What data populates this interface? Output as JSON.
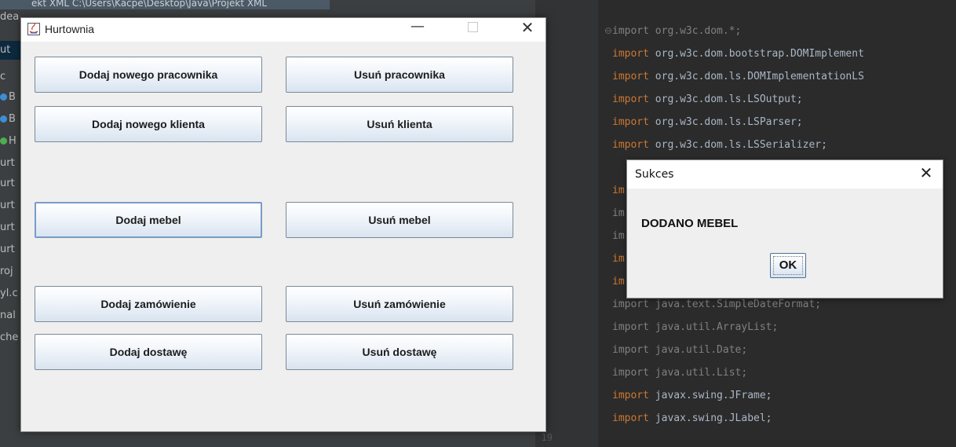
{
  "ide": {
    "project_path": "ekt XML  C:\\Users\\Kacpe\\Desktop\\Java\\Projekt XML",
    "side_fragments": [
      {
        "text": "dea",
        "dot": ""
      },
      {
        "text": "ut",
        "dot": ""
      },
      {
        "text": "c",
        "dot": ""
      },
      {
        "text": "B",
        "dot": "#3d8ed6"
      },
      {
        "text": "B",
        "dot": "#3d8ed6"
      },
      {
        "text": "H",
        "dot": "#4caf50"
      },
      {
        "text": "urt",
        "dot": ""
      },
      {
        "text": "urt",
        "dot": ""
      },
      {
        "text": "urt",
        "dot": ""
      },
      {
        "text": "urt",
        "dot": ""
      },
      {
        "text": "urt",
        "dot": ""
      },
      {
        "text": "roj",
        "dot": ""
      },
      {
        "text": "yl.c",
        "dot": ""
      },
      {
        "text": "nal",
        "dot": ""
      },
      {
        "text": "che",
        "dot": ""
      }
    ],
    "visible_line_number": "19",
    "code_lines": [
      {
        "kw": "import",
        "rest": " org.w3c.dom.*;",
        "dim": true
      },
      {
        "kw": "import",
        "rest": " org.w3c.dom.bootstrap.DOMImplement",
        "dim": false
      },
      {
        "kw": "import",
        "rest": " org.w3c.dom.ls.DOMImplementationLS",
        "dim": false
      },
      {
        "kw": "import",
        "rest": " org.w3c.dom.ls.LSOutput;",
        "dim": false
      },
      {
        "kw": "import",
        "rest": " org.w3c.dom.ls.LSParser;",
        "dim": false
      },
      {
        "kw": "import",
        "rest": " org.w3c.dom.ls.LSSerializer;",
        "dim": false
      },
      {
        "kw": "",
        "rest": "",
        "dim": false
      },
      {
        "kw": "im",
        "rest": "",
        "dim": false
      },
      {
        "kw": "im",
        "rest": "",
        "dim": true
      },
      {
        "kw": "im",
        "rest": "",
        "dim": true
      },
      {
        "kw": "im",
        "rest": "",
        "dim": false
      },
      {
        "kw": "im",
        "rest": "",
        "dim": false
      },
      {
        "kw": "import",
        "rest": " java.text.SimpleDateFormat;",
        "dim": true
      },
      {
        "kw": "import",
        "rest": " java.util.ArrayList;",
        "dim": true
      },
      {
        "kw": "import",
        "rest": " java.util.Date;",
        "dim": true
      },
      {
        "kw": "import",
        "rest": " java.util.List;",
        "dim": true
      },
      {
        "kw": "import",
        "rest": " javax.swing.JFrame;",
        "dim": false
      },
      {
        "kw": "import",
        "rest": " javax.swing.JLabel;",
        "dim": false
      }
    ]
  },
  "window": {
    "title": "Hurtownia",
    "minimize_glyph": "—",
    "close_glyph": "✕",
    "buttons": {
      "add_employee": "Dodaj nowego pracownika",
      "remove_employee": "Usuń pracownika",
      "add_client": "Dodaj nowego klienta",
      "remove_client": "Usuń klienta",
      "add_furniture": "Dodaj mebel",
      "remove_furniture": "Usuń mebel",
      "add_order": "Dodaj zamówienie",
      "remove_order": "Usuń zamówienie",
      "add_delivery": "Dodaj dostawę",
      "remove_delivery": "Usuń dostawę"
    }
  },
  "dialog": {
    "title": "Sukces",
    "close_glyph": "✕",
    "message": "DODANO MEBEL",
    "ok_label": "OK"
  }
}
